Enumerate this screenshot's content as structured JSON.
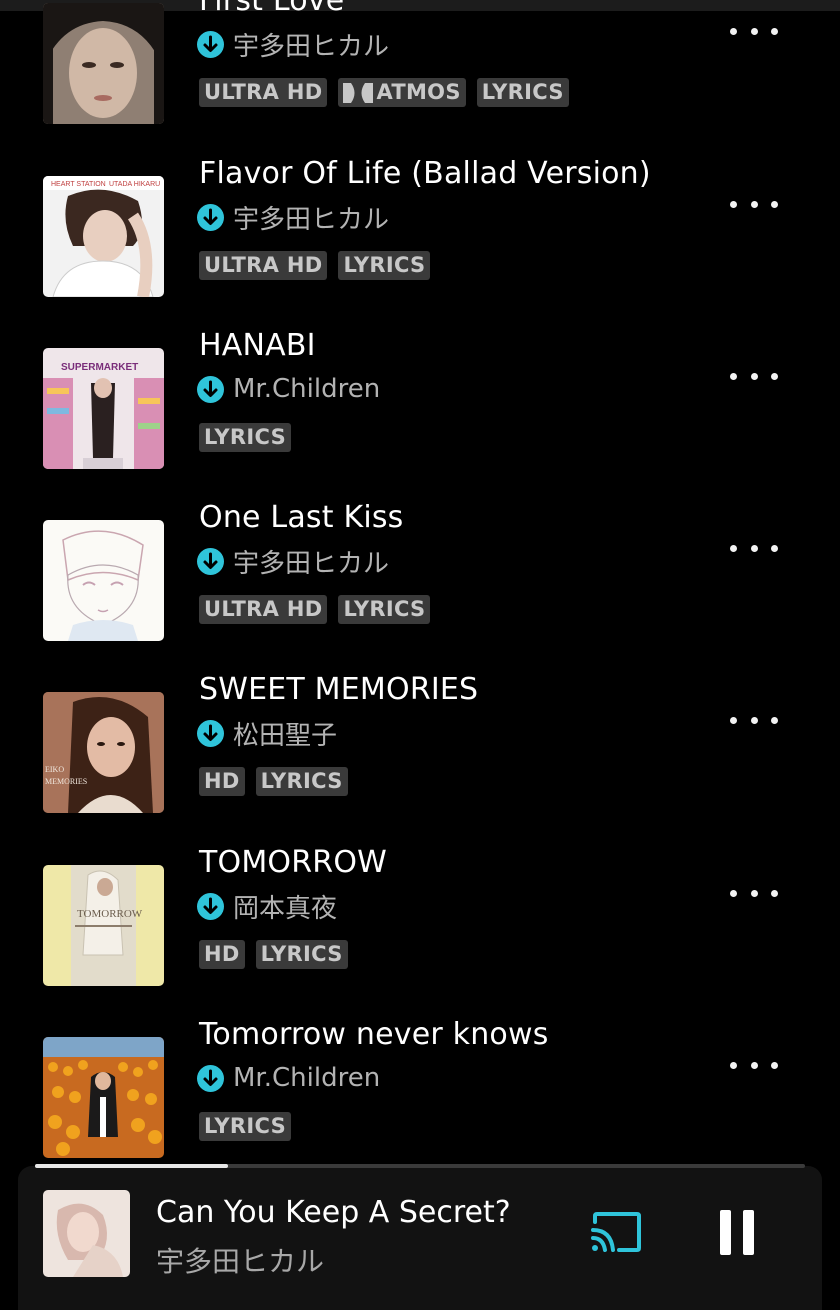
{
  "colors": {
    "accent": "#2fc4da",
    "background": "#000000",
    "badge_bg": "#3a3a3a"
  },
  "tracks": [
    {
      "title": "First Love",
      "artist": "宇多田ヒカル",
      "badges": [
        "ULTRA HD",
        "ATMOS",
        "LYRICS"
      ],
      "downloaded": true,
      "art": "first-love-cover",
      "more": "more-icon"
    },
    {
      "title": "Flavor Of Life (Ballad Version)",
      "artist": "宇多田ヒカル",
      "badges": [
        "ULTRA HD",
        "LYRICS"
      ],
      "downloaded": true,
      "art": "heart-station-cover",
      "more": "more-icon"
    },
    {
      "title": "HANABI",
      "artist": "Mr.Children",
      "badges": [
        "LYRICS"
      ],
      "downloaded": true,
      "art": "supermarket-fantasy-cover",
      "more": "more-icon"
    },
    {
      "title": "One Last Kiss",
      "artist": "宇多田ヒカル",
      "badges": [
        "ULTRA HD",
        "LYRICS"
      ],
      "downloaded": true,
      "art": "one-last-kiss-cover",
      "more": "more-icon"
    },
    {
      "title": "SWEET MEMORIES",
      "artist": "松田聖子",
      "badges": [
        "HD",
        "LYRICS"
      ],
      "downloaded": true,
      "art": "sweet-memories-cover",
      "more": "more-icon"
    },
    {
      "title": "TOMORROW",
      "artist": "岡本真夜",
      "badges": [
        "HD",
        "LYRICS"
      ],
      "downloaded": true,
      "art": "tomorrow-cover",
      "more": "more-icon"
    },
    {
      "title": "Tomorrow never knows",
      "artist": "Mr.Children",
      "badges": [
        "LYRICS"
      ],
      "downloaded": true,
      "art": "tomorrow-never-knows-cover",
      "more": "more-icon"
    }
  ],
  "now_playing": {
    "title": "Can You Keep A Secret?",
    "artist": "宇多田ヒカル",
    "progress": 0.25,
    "cast_icon": "cast-icon",
    "pause_icon": "pause-icon"
  }
}
